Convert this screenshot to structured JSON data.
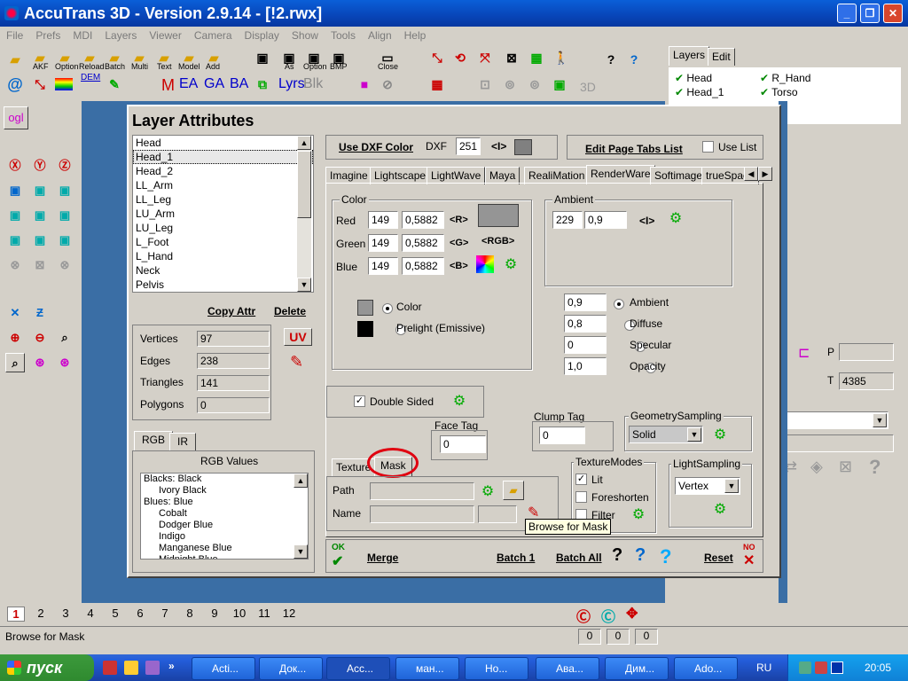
{
  "app": {
    "title": "AccuTrans 3D - Version 2.9.14 - [!2.rwx]"
  },
  "menu": [
    "File",
    "Prefs",
    "MDI",
    "Layers",
    "Viewer",
    "Camera",
    "Display",
    "Show",
    "Tools",
    "Align",
    "Help"
  ],
  "toolbar": {
    "row1_labels": [
      "AKF",
      "Option",
      "Reload",
      "Batch",
      "Multi",
      "Text",
      "Model",
      "Add",
      "As",
      "Option",
      "BMP",
      "Close"
    ],
    "row2_text": {
      "m": "M",
      "ea": "EA",
      "ga": "GA",
      "ba": "BA",
      "lyrs": "Lyrs",
      "blks": "Blk",
      "dem": "DEM",
      "3d": "3D"
    }
  },
  "left_panel": {
    "ogl": "ogl"
  },
  "right_panel": {
    "tabs": [
      "Layers",
      "Edit"
    ],
    "layers": [
      "Head",
      "R_Hand",
      "Head_1",
      "Torso"
    ],
    "p_label": "P",
    "t_label": "T",
    "t_value": "4385",
    "o_value": "0"
  },
  "dialog": {
    "title": "Layer Attributes",
    "layer_list": [
      "Head",
      "Head_1",
      "Head_2",
      "LL_Arm",
      "LL_Leg",
      "LU_Arm",
      "LU_Leg",
      "L_Foot",
      "L_Hand",
      "Neck",
      "Pelvis"
    ],
    "selected_layer": "Head_1",
    "copy_attr": "Copy Attr",
    "delete": "Delete",
    "stats": [
      {
        "label": "Vertices",
        "value": "97"
      },
      {
        "label": "Edges",
        "value": "238"
      },
      {
        "label": "Triangles",
        "value": "141"
      },
      {
        "label": "Polygons",
        "value": "0"
      }
    ],
    "uv_button": "UV",
    "rgb_tabs": [
      "RGB",
      "IR"
    ],
    "rgb_values_title": "RGB Values",
    "rgb_values": [
      "Blacks: Black",
      "Ivory Black",
      "Blues: Blue",
      "Cobalt",
      "Dodger Blue",
      "Indigo",
      "Manganese Blue",
      "Midnight Blue"
    ],
    "use_dxf_color": "Use DXF Color",
    "dxf_label": "DXF",
    "dxf_value": "251",
    "dxf_arrows": "<I>",
    "edit_page_tabs": "Edit Page Tabs List",
    "use_list": "Use List",
    "format_tabs": [
      "Imagine",
      "Lightscape",
      "LightWave",
      "Maya",
      "RealiMation",
      "RenderWare",
      "Softimage",
      "trueSpace"
    ],
    "active_format_tab": "RenderWare",
    "color_group": "Color",
    "color_rows": [
      {
        "label": "Red",
        "int": "149",
        "float": "0,5882",
        "btn": "<R>"
      },
      {
        "label": "Green",
        "int": "149",
        "float": "0,5882",
        "btn": "<G>"
      },
      {
        "label": "Blue",
        "int": "149",
        "float": "0,5882",
        "btn": "<B>"
      }
    ],
    "rgb_btn": "<RGB>",
    "swatch_color": "#959595",
    "color_radio": "Color",
    "prelight_radio": "Prelight (Emissive)",
    "ambient_group": "Ambient",
    "ambient_int": "229",
    "ambient_float": "0,9",
    "ambient_arrows": "<I>",
    "light_rows": [
      {
        "value": "0,9",
        "label": "Ambient",
        "on": true
      },
      {
        "value": "0,8",
        "label": "Diffuse",
        "on": false
      },
      {
        "value": "0",
        "label": "Specular",
        "on": false
      },
      {
        "value": "1,0",
        "label": "Opacity",
        "on": false
      }
    ],
    "double_sided": "Double Sided",
    "face_tag_label": "Face Tag",
    "face_tag_value": "0",
    "clump_tag_label": "Clump Tag",
    "clump_tag_value": "0",
    "geometry_sampling_label": "GeometrySampling",
    "geometry_sampling_value": "Solid",
    "texture_tabs": [
      "Texture",
      "Mask"
    ],
    "path_label": "Path",
    "name_label": "Name",
    "texture_modes_label": "TextureModes",
    "texture_modes": [
      {
        "label": "Lit",
        "checked": true
      },
      {
        "label": "Foreshorten",
        "checked": false
      },
      {
        "label": "Filter",
        "checked": false
      }
    ],
    "light_sampling_label": "LightSampling",
    "light_sampling_value": "Vertex",
    "tooltip": "Browse for Mask",
    "ok": "OK",
    "merge": "Merge",
    "batch1": "Batch 1",
    "batch_all": "Batch All",
    "reset": "Reset",
    "no": "NO"
  },
  "pages": [
    "1",
    "2",
    "3",
    "4",
    "5",
    "6",
    "7",
    "8",
    "9",
    "10",
    "11",
    "12"
  ],
  "status": {
    "text": "Browse for Mask",
    "v1": "0",
    "v2": "0",
    "v3": "0"
  },
  "taskbar": {
    "start": "пуск",
    "items": [
      "Acti...",
      "Док...",
      "Acc...",
      "ман...",
      "Но...",
      "Ава...",
      "Дим...",
      "Ado..."
    ],
    "lang": "RU",
    "clock": "20:05"
  }
}
